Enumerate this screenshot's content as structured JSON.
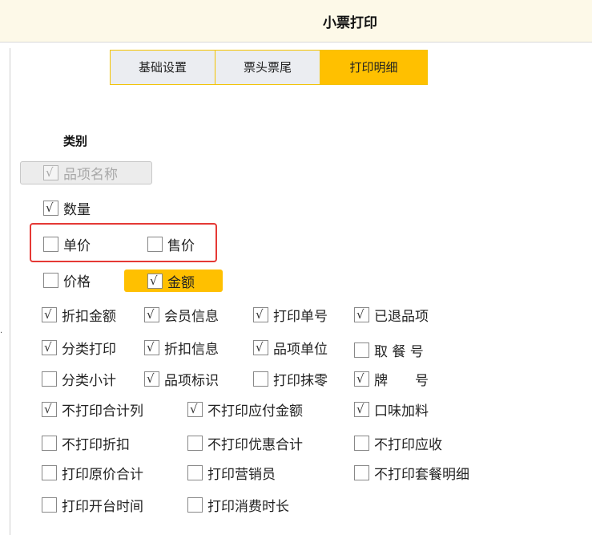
{
  "header": {
    "title": "小票打印"
  },
  "tabs": [
    {
      "label": "基础设置",
      "active": false
    },
    {
      "label": "票头票尾",
      "active": false
    },
    {
      "label": "打印明细",
      "active": true
    }
  ],
  "section": {
    "label": "类别"
  },
  "colors": {
    "accent": "#ffc000",
    "highlight_border": "#e53935"
  },
  "check_glyph": "√",
  "items": {
    "item_name": {
      "label": "品项名称",
      "checked": true,
      "disabled": true
    },
    "quantity": {
      "label": "数量",
      "checked": true
    },
    "unit_price": {
      "label": "单价",
      "checked": false
    },
    "sale_price": {
      "label": "售价",
      "checked": false
    },
    "price": {
      "label": "价格",
      "checked": false
    },
    "amount": {
      "label": "金额",
      "checked": true
    },
    "discount_amount": {
      "label": "折扣金额",
      "checked": true
    },
    "member_info": {
      "label": "会员信息",
      "checked": true
    },
    "print_bill_no": {
      "label": "打印单号",
      "checked": true
    },
    "returned_items": {
      "label": "已退品项",
      "checked": true
    },
    "print_by_category": {
      "label": "分类打印",
      "checked": true
    },
    "discount_info": {
      "label": "折扣信息",
      "checked": true
    },
    "item_unit": {
      "label": "品项单位",
      "checked": true
    },
    "pickup_no": {
      "label": "取 餐 号",
      "checked": false
    },
    "category_subtotal": {
      "label": "分类小计",
      "checked": false
    },
    "item_tag": {
      "label": "品项标识",
      "checked": true
    },
    "print_rounding": {
      "label": "打印抹零",
      "checked": false
    },
    "plate_no": {
      "label": "牌　　号",
      "checked": true
    },
    "no_print_total_col": {
      "label": "不打印合计列",
      "checked": true
    },
    "no_print_payable": {
      "label": "不打印应付金额",
      "checked": true
    },
    "flavor_addons": {
      "label": "口味加料",
      "checked": true
    },
    "no_print_discount": {
      "label": "不打印折扣",
      "checked": false
    },
    "no_print_promo_total": {
      "label": "不打印优惠合计",
      "checked": false
    },
    "no_print_receivable": {
      "label": "不打印应收",
      "checked": false
    },
    "print_original_total": {
      "label": "打印原价合计",
      "checked": false
    },
    "print_salesperson": {
      "label": "打印营销员",
      "checked": false
    },
    "no_print_set_detail": {
      "label": "不打印套餐明细",
      "checked": false
    },
    "print_open_time": {
      "label": "打印开台时间",
      "checked": false
    },
    "print_duration": {
      "label": "打印消费时长",
      "checked": false
    }
  }
}
